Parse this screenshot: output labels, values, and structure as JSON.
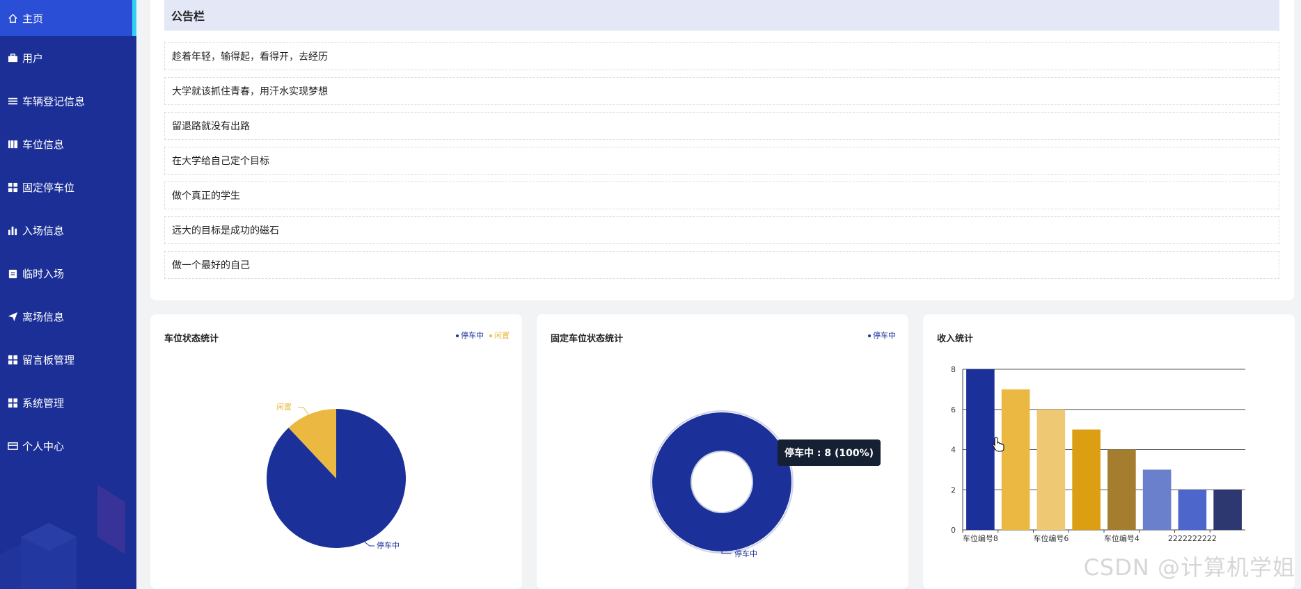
{
  "sidebar": {
    "items": [
      {
        "label": "主页",
        "icon": "home-icon"
      },
      {
        "label": "用户",
        "icon": "briefcase-icon"
      },
      {
        "label": "车辆登记信息",
        "icon": "list-icon"
      },
      {
        "label": "车位信息",
        "icon": "book-icon"
      },
      {
        "label": "固定停车位",
        "icon": "grid-icon"
      },
      {
        "label": "入场信息",
        "icon": "bar-chart-icon"
      },
      {
        "label": "临时入场",
        "icon": "clipboard-icon"
      },
      {
        "label": "离场信息",
        "icon": "send-icon"
      },
      {
        "label": "留言板管理",
        "icon": "grid-icon"
      },
      {
        "label": "系统管理",
        "icon": "grid-icon"
      },
      {
        "label": "个人中心",
        "icon": "credit-card-icon"
      }
    ]
  },
  "notice": {
    "title": "公告栏",
    "items": [
      "趁着年轻，输得起，看得开，去经历",
      "大学就该抓住青春，用汗水实现梦想",
      "留退路就没有出路",
      "在大学给自己定个目标",
      "做个真正的学生",
      "远大的目标是成功的磁石",
      "做一个最好的自己"
    ]
  },
  "colors": {
    "sidebar_bg": "#1b2f96",
    "active_bg": "#2a4fd6",
    "accent": "#2fd0f5",
    "primary": "#1b3199",
    "yellow": "#ebb942"
  },
  "charts": {
    "parking_status": {
      "title": "车位状态统计",
      "legend": [
        "停车中",
        "闲置"
      ]
    },
    "fixed_status": {
      "title": "固定车位状态统计",
      "legend": [
        "停车中"
      ],
      "tooltip": "停车中 : 8 (100%)"
    },
    "income": {
      "title": "收入统计"
    }
  },
  "chart_data": [
    {
      "type": "pie",
      "title": "车位状态统计",
      "labels": [
        "停车中",
        "闲置"
      ],
      "values": [
        88,
        12
      ],
      "colors": [
        "#1b3199",
        "#ebb942"
      ]
    },
    {
      "type": "pie",
      "title": "固定车位状态统计",
      "labels": [
        "停车中"
      ],
      "values": [
        8
      ],
      "colors": [
        "#1b3199"
      ],
      "donut": true
    },
    {
      "type": "bar",
      "title": "收入统计",
      "categories": [
        "车位编号8",
        "",
        "车位编号6",
        "",
        "车位编号4",
        "",
        "2222222222",
        ""
      ],
      "values": [
        8,
        7,
        6,
        5,
        4,
        3,
        2,
        2
      ],
      "colors": [
        "#1b3199",
        "#ebb942",
        "#eec872",
        "#dc9f13",
        "#a47e2e",
        "#6b80cc",
        "#4d66cc",
        "#2c386f"
      ],
      "ylim": [
        0,
        8
      ],
      "yticks": [
        0,
        2,
        4,
        6,
        8
      ],
      "grid": true
    }
  ],
  "watermark": "CSDN @计算机学姐"
}
